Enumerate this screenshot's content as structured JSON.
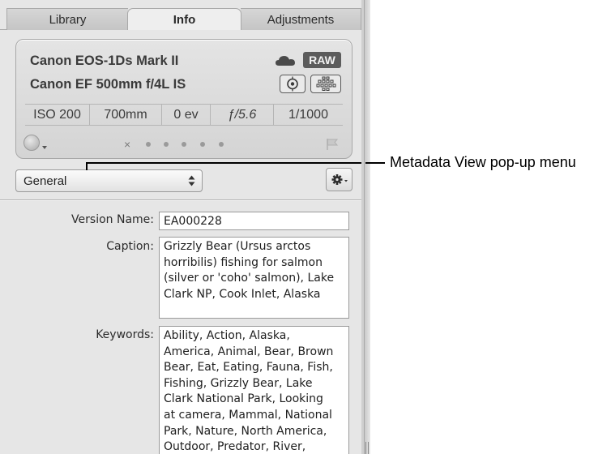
{
  "tabs": [
    {
      "label": "Library"
    },
    {
      "label": "Info"
    },
    {
      "label": "Adjustments"
    }
  ],
  "camera": {
    "body": "Canon EOS-1Ds Mark II",
    "lens": "Canon EF 500mm f/4L IS",
    "raw_badge": "RAW",
    "exif": {
      "iso": "ISO 200",
      "focal_length": "700mm",
      "exposure_bias": "0 ev",
      "aperture": "ƒ/5.6",
      "shutter": "1/1000"
    },
    "rating_reject": "×",
    "rating_dots": 5
  },
  "metadata_view": {
    "selected": "General"
  },
  "fields": {
    "version_name": {
      "label": "Version Name:",
      "value": "EA000228"
    },
    "caption": {
      "label": "Caption:",
      "value": "Grizzly Bear (Ursus arctos\nhorribilis) fishing for salmon\n(silver or 'coho' salmon), Lake\nClark NP, Cook Inlet, Alaska"
    },
    "keywords": {
      "label": "Keywords:",
      "value": "Ability, Action, Alaska,\nAmerica, Animal, Bear, Brown\nBear, Eat, Eating, Fauna, Fish,\nFishing, Grizzly Bear, Lake\nClark National Park, Looking\nat camera, Mammal, National\nPark, Nature, North America,\nOutdoor, Predator, River,"
    }
  },
  "callout": {
    "text": "Metadata View pop-up menu"
  },
  "icons": [
    "cloud-icon",
    "focus-point-icon",
    "grid-icon",
    "color-label-icon",
    "flag-icon",
    "select-arrows-icon",
    "gear-icon"
  ]
}
